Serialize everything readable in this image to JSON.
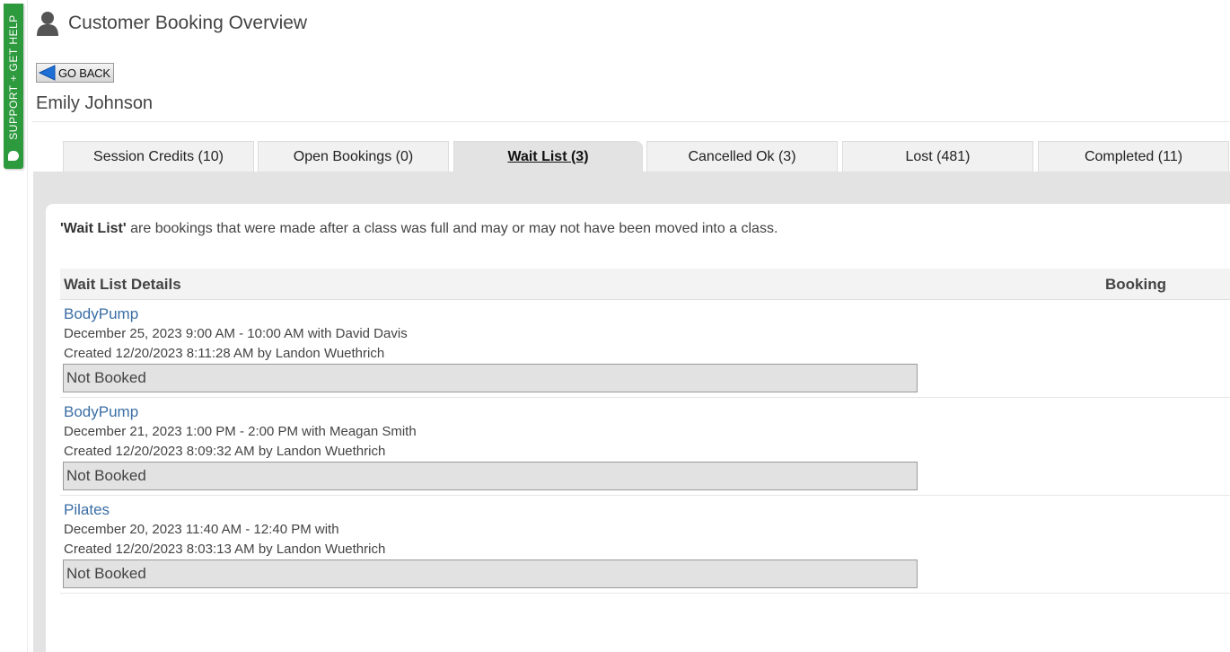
{
  "support": {
    "label": "SUPPORT + GET HELP"
  },
  "header": {
    "title": "Customer Booking Overview"
  },
  "go_back": {
    "label": "GO BACK"
  },
  "customer": {
    "name": "Emily Johnson"
  },
  "tabs": [
    {
      "label": "Session Credits (10)",
      "active": false
    },
    {
      "label": "Open Bookings (0)",
      "active": false
    },
    {
      "label": "Wait List (3)",
      "active": true
    },
    {
      "label": "Cancelled Ok (3)",
      "active": false
    },
    {
      "label": "Lost (481)",
      "active": false
    },
    {
      "label": "Completed (11)",
      "active": false
    }
  ],
  "intro": {
    "term": "'Wait List'",
    "text": " are bookings that were made after a class was full and may or may not have been moved into a class."
  },
  "table": {
    "headers": {
      "details": "Wait List Details",
      "booking": "Booking"
    },
    "rows": [
      {
        "class_name": "BodyPump",
        "when": "December 25, 2023 9:00 AM - 10:00 AM with David Davis",
        "created": "Created 12/20/2023 8:11:28 AM by Landon Wuethrich",
        "status": "Not Booked"
      },
      {
        "class_name": "BodyPump",
        "when": "December 21, 2023 1:00 PM - 2:00 PM with Meagan Smith",
        "created": "Created 12/20/2023 8:09:32 AM by Landon Wuethrich",
        "status": "Not Booked"
      },
      {
        "class_name": "Pilates",
        "when": "December 20, 2023 11:40 AM - 12:40 PM with",
        "created": "Created 12/20/2023 8:03:13 AM by Landon Wuethrich",
        "status": "Not Booked"
      }
    ]
  },
  "icons": {
    "user": "user-silhouette-icon",
    "back": "back-arrow-icon",
    "chat": "chat-bubble-icon"
  },
  "colors": {
    "support_green": "#2e9a3e",
    "link_blue": "#3a6ea5",
    "back_arrow_blue": "#1e6fd6",
    "panel_grey": "#e3e3e3"
  }
}
